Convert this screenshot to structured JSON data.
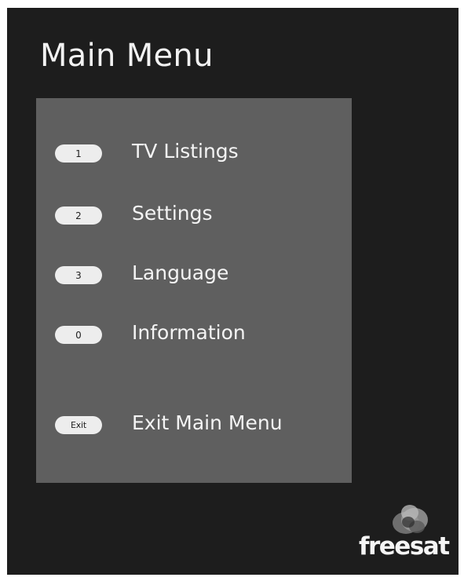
{
  "menu": {
    "title": "Main Menu",
    "items": [
      {
        "key": "1",
        "label": "TV Listings"
      },
      {
        "key": "2",
        "label": "Settings"
      },
      {
        "key": "3",
        "label": "Language"
      },
      {
        "key": "0",
        "label": "Information"
      }
    ],
    "exit": {
      "key": "Exit",
      "label": "Exit Main Menu"
    }
  },
  "brand": {
    "logo_text": "freesat",
    "logo_icon": "freesat-logo-icon"
  },
  "colors": {
    "screen_background": "#1d1d1d",
    "panel_background": "#5f5f5f",
    "key_background": "#ededed",
    "text": "#f4f4f4"
  }
}
